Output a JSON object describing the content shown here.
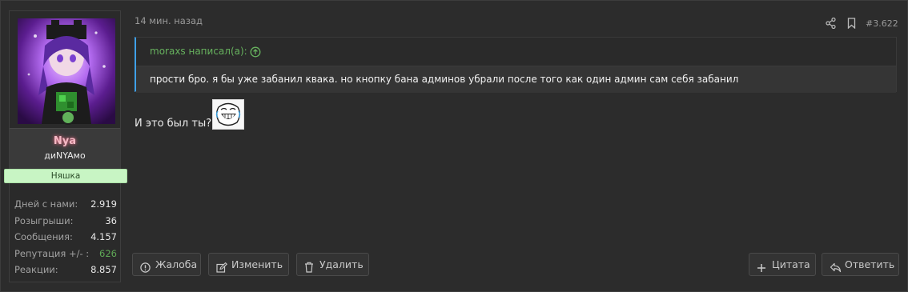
{
  "user": {
    "name": "Nya",
    "title": "диNYAмо",
    "banner": "Няшка",
    "stats": [
      {
        "label": "Дней с нами:",
        "value": "2.919"
      },
      {
        "label": "Розыгрыши:",
        "value": "36"
      },
      {
        "label": "Сообщения:",
        "value": "4.157"
      },
      {
        "label": "Репутация +/- :",
        "value": "626"
      },
      {
        "label": "Реакции:",
        "value": "8.857"
      }
    ]
  },
  "post": {
    "timestamp": "14 мин. назад",
    "number": "#3.622",
    "quote": {
      "author": "moraxs написал(а):",
      "text": "прости бро. я бы уже забанил квака. но кнопку бана админов убрали после того как один админ сам себя забанил"
    },
    "message": "И это был ты?"
  },
  "actions": {
    "report": "Жалоба",
    "edit": "Изменить",
    "delete": "Удалить",
    "quote": "Цитата",
    "reply": "Ответить"
  },
  "colors": {
    "background": "#2c2c2c",
    "quote_accent": "#3fa0e8",
    "username": "#f4b9c5",
    "positive": "#5fa856",
    "banner_bg": "#c8f5c4"
  },
  "icons": [
    "share-icon",
    "bookmark-icon",
    "up-arrow-icon",
    "report-icon",
    "edit-icon",
    "trash-icon",
    "plus-icon",
    "reply-icon"
  ]
}
